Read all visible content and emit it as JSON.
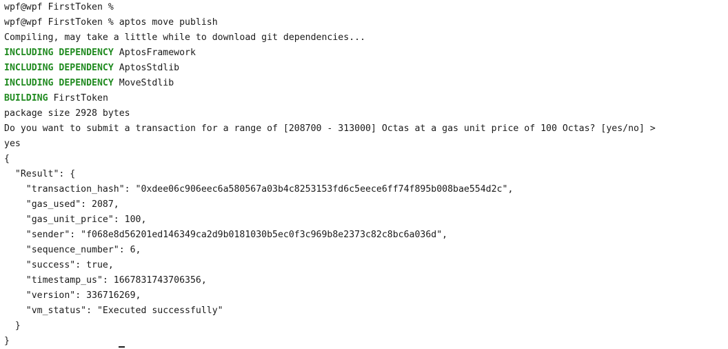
{
  "terminal": {
    "prompt_1": "wpf@wpf FirstToken %",
    "prompt_2": "wpf@wpf FirstToken % aptos move publish",
    "compiling": "Compiling, may take a little while to download git dependencies...",
    "deps": [
      {
        "keyword": "INCLUDING DEPENDENCY",
        "name": "AptosFramework"
      },
      {
        "keyword": "INCLUDING DEPENDENCY",
        "name": "AptosStdlib"
      },
      {
        "keyword": "INCLUDING DEPENDENCY",
        "name": "MoveStdlib"
      }
    ],
    "building": {
      "keyword": "BUILDING",
      "name": "FirstToken"
    },
    "package_size": "package size 2928 bytes",
    "question": "Do you want to submit a transaction for a range of [208700 - 313000] Octas at a gas unit price of 100 Octas? [yes/no] >",
    "answer": "yes",
    "json_lines": [
      "{",
      "  \"Result\": {",
      "    \"transaction_hash\": \"0xdee06c906eec6a580567a03b4c8253153fd6c5eece6ff74f895b008bae554d2c\",",
      "    \"gas_used\": 2087,",
      "    \"gas_unit_price\": 100,",
      "    \"sender\": \"f068e8d56201ed146349ca2d9b0181030b5ec0f3c969b8e2373c82c8bc6a036d\",",
      "    \"sequence_number\": 6,",
      "    \"success\": true,",
      "    \"timestamp_us\": 1667831743706356,",
      "    \"version\": 336716269,",
      "    \"vm_status\": \"Executed successfully\"",
      "  }",
      "}"
    ],
    "colors": {
      "keyword": "#1f8a1f",
      "text": "#1a1a1a",
      "background": "#ffffff"
    }
  }
}
